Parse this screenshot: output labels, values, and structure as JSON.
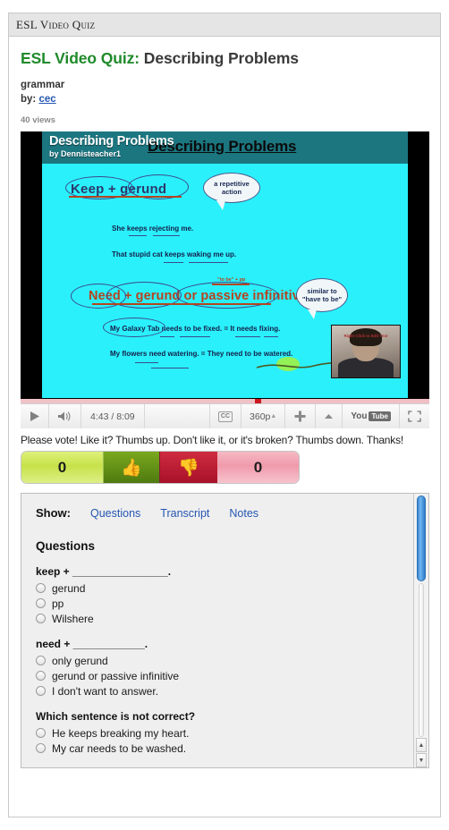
{
  "window": {
    "title": "ESL Video Quiz"
  },
  "header": {
    "title_green": "ESL Video Quiz:",
    "title_dark": "Describing Problems",
    "category": "grammar",
    "by_label": "by:",
    "author": "cec",
    "views": "40 views"
  },
  "video": {
    "overlay_title": "Describing Problems",
    "overlay_author": "by Dennisteacher1",
    "slide_title": "Describing Problems",
    "slide": {
      "rule1": "Keep + gerund",
      "bubble1": "a repetitive action",
      "example1": "She keeps rejecting me.",
      "example2": "That stupid cat keeps waking me up.",
      "rule2": "Need + gerund or passive infinitive",
      "tobe_note": "\"to be\" + pp",
      "bubble2": "similar to \"have to be\"",
      "example3": "My Galaxy Tab needs to be fixed.  =  It needs fixing.",
      "example4": "My flowers need watering.  =  They need to be watered.",
      "webcam_caption": "Right Click to Edit Text"
    },
    "controls": {
      "play": "play-button",
      "volume": "volume-button",
      "time": "4:43 / 8:09",
      "cc": "CC",
      "quality": "360p",
      "add": "+",
      "expand": "▲",
      "youtube": "You",
      "youtube_box": "Tube",
      "fullscreen": "fullscreen-button"
    },
    "progress_percent": 58
  },
  "vote": {
    "prompt": "Please vote!  Like it? Thumbs up.  Don't like it, or it's broken? Thumbs down.  Thanks!",
    "up_count": "0",
    "down_count": "0",
    "up_icon": "👍",
    "down_icon": "👎"
  },
  "panel": {
    "show_label": "Show:",
    "tabs": [
      {
        "label": "Questions"
      },
      {
        "label": "Transcript"
      },
      {
        "label": "Notes"
      }
    ],
    "section_heading": "Questions",
    "questions": [
      {
        "prompt": "keep + ________________.",
        "options": [
          "gerund",
          "pp",
          "Wilshere"
        ]
      },
      {
        "prompt": "need + ____________.",
        "options": [
          "only gerund",
          "gerund or passive infinitive",
          "I don't want to answer."
        ]
      },
      {
        "prompt": "Which sentence is not correct?",
        "options": [
          "He keeps breaking my heart.",
          "My car needs to be washed."
        ]
      }
    ],
    "scroll_up": "▲",
    "scroll_down": "▼"
  },
  "colors": {
    "accent_green": "#1f8a2a",
    "link_blue": "#2556b2",
    "slide_cyan": "#2af0fb",
    "slide_header": "#1c7680",
    "vote_up": "#4e7a10",
    "vote_down": "#a8112a"
  }
}
